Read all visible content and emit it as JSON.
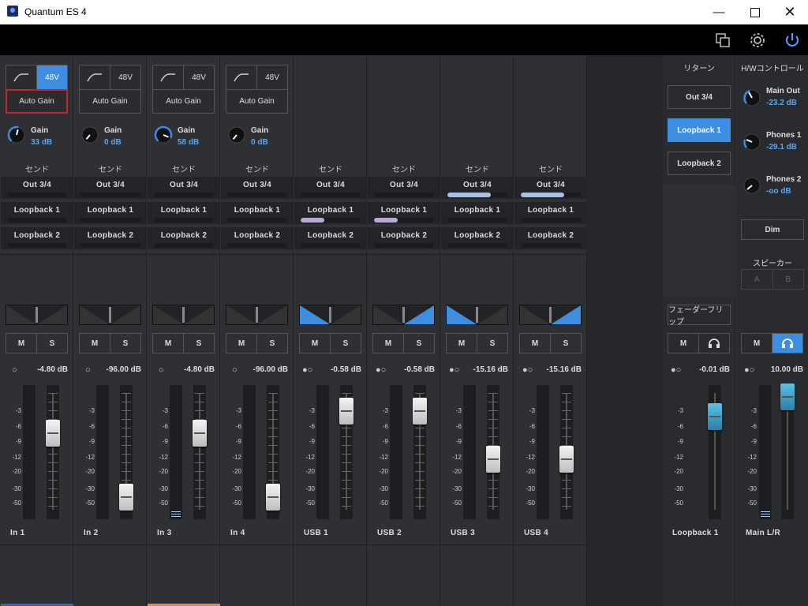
{
  "window": {
    "title": "Quantum ES 4"
  },
  "strips": [
    {
      "name": "In  1",
      "type": "input",
      "v48": "48V",
      "v48_on": true,
      "auto_gain": "Auto Gain",
      "auto_gain_selected": true,
      "gain_label": "Gain",
      "gain": "33 dB",
      "gain_level": 0.55,
      "send_header": "センド",
      "sends": [
        {
          "label": "Out  3/4",
          "level": 0
        },
        {
          "label": "Loopback  1",
          "level": 0
        },
        {
          "label": "Loopback  2",
          "level": 0
        }
      ],
      "pan": "center",
      "mute": "M",
      "solo": "S",
      "db": "-4.80 dB",
      "linked": false,
      "fader_level": 0.66,
      "meter_level": 0,
      "color": "#2d5fe0"
    },
    {
      "name": "In  2",
      "type": "input",
      "v48": "48V",
      "v48_on": false,
      "auto_gain": "Auto Gain",
      "auto_gain_selected": false,
      "gain_label": "Gain",
      "gain": "0 dB",
      "gain_level": 0,
      "send_header": "センド",
      "sends": [
        {
          "label": "Out  3/4",
          "level": 0
        },
        {
          "label": "Loopback  1",
          "level": 0
        },
        {
          "label": "Loopback  2",
          "level": 0
        }
      ],
      "pan": "center",
      "mute": "M",
      "solo": "S",
      "db": "-96.00 dB",
      "linked": false,
      "fader_level": 0.12,
      "meter_level": 0,
      "color": ""
    },
    {
      "name": "In  3",
      "type": "input",
      "v48": "48V",
      "v48_on": false,
      "auto_gain": "Auto Gain",
      "auto_gain_selected": false,
      "gain_label": "Gain",
      "gain": "58 dB",
      "gain_level": 0.9,
      "send_header": "センド",
      "sends": [
        {
          "label": "Out  3/4",
          "level": 0
        },
        {
          "label": "Loopback  1",
          "level": 0
        },
        {
          "label": "Loopback  2",
          "level": 0
        }
      ],
      "pan": "center",
      "mute": "M",
      "solo": "S",
      "db": "-4.80 dB",
      "linked": false,
      "fader_level": 0.66,
      "meter_level": 0.04,
      "color": "#e58a3c"
    },
    {
      "name": "In  4",
      "type": "input",
      "v48": "48V",
      "v48_on": false,
      "auto_gain": "Auto Gain",
      "auto_gain_selected": false,
      "gain_label": "Gain",
      "gain": "0 dB",
      "gain_level": 0,
      "send_header": "センド",
      "sends": [
        {
          "label": "Out  3/4",
          "level": 0
        },
        {
          "label": "Loopback  1",
          "level": 0
        },
        {
          "label": "Loopback  2",
          "level": 0
        }
      ],
      "pan": "center",
      "mute": "M",
      "solo": "S",
      "db": "-96.00 dB",
      "linked": false,
      "fader_level": 0.12,
      "meter_level": 0,
      "color": ""
    },
    {
      "name": "USB  1",
      "type": "usb",
      "send_header": "センド",
      "sends": [
        {
          "label": "Out  3/4",
          "level": 0
        },
        {
          "label": "Loopback  1",
          "level": 0.4
        },
        {
          "label": "Loopback  2",
          "level": 0
        }
      ],
      "pan": "left",
      "mute": "M",
      "solo": "S",
      "db": "-0.58 dB",
      "linked": true,
      "fader_level": 0.85,
      "meter_level": 0,
      "color": ""
    },
    {
      "name": "USB  2",
      "type": "usb",
      "send_header": "センド",
      "sends": [
        {
          "label": "Out  3/4",
          "level": 0
        },
        {
          "label": "Loopback  1",
          "level": 0.4
        },
        {
          "label": "Loopback  2",
          "level": 0
        }
      ],
      "pan": "right",
      "mute": "M",
      "solo": "S",
      "db": "-0.58 dB",
      "linked": true,
      "fader_level": 0.85,
      "meter_level": 0,
      "color": ""
    },
    {
      "name": "USB  3",
      "type": "usb",
      "send_header": "センド",
      "sends": [
        {
          "label": "Out  3/4",
          "level": 0.72
        },
        {
          "label": "Loopback  1",
          "level": 0
        },
        {
          "label": "Loopback  2",
          "level": 0
        }
      ],
      "pan": "left",
      "mute": "M",
      "solo": "S",
      "db": "-15.16 dB",
      "linked": true,
      "fader_level": 0.44,
      "meter_level": 0,
      "color": ""
    },
    {
      "name": "USB  4",
      "type": "usb",
      "send_header": "センド",
      "sends": [
        {
          "label": "Out  3/4",
          "level": 0.72
        },
        {
          "label": "Loopback  1",
          "level": 0
        },
        {
          "label": "Loopback  2",
          "level": 0
        }
      ],
      "pan": "right",
      "mute": "M",
      "solo": "S",
      "db": "-15.16 dB",
      "linked": true,
      "fader_level": 0.44,
      "meter_level": 0,
      "color": ""
    }
  ],
  "return": {
    "header": "リターン",
    "buttons": [
      {
        "label": "Out  3/4",
        "on": false
      },
      {
        "label": "Loopback  1",
        "on": true
      },
      {
        "label": "Loopback  2",
        "on": false
      }
    ],
    "fader_flip": "フェーダーフリップ",
    "mute": "M",
    "headphone_icon": "headphone-icon",
    "db": "-0.01 dB",
    "linked": true,
    "fader_level": 0.8,
    "name": "Loopback  1"
  },
  "hw": {
    "header": "H/Wコントロール",
    "outputs": [
      {
        "name": "Main Out",
        "value": "-23.2 dB",
        "level": 0.45
      },
      {
        "name": "Phones 1",
        "value": "-29.1 dB",
        "level": 0.35
      },
      {
        "name": "Phones 2",
        "value": "-oo dB",
        "level": 0
      }
    ],
    "dim": "Dim",
    "speaker_header": "スピーカー",
    "speaker_a": "A",
    "speaker_b": "B",
    "mute": "M",
    "headphone_icon": "headphone-icon",
    "db": "10.00 dB",
    "linked": true,
    "fader_level": 0.97,
    "meter_level": 0.04,
    "name": "Main L/R"
  },
  "scale_labels": [
    "-3",
    "-6",
    "-9",
    "-12",
    "-20",
    "-30",
    "-50"
  ],
  "colors": {
    "accent": "#3d8ee0",
    "value_text": "#5aa6ef",
    "send_fill": "#b9a9d9",
    "send_fill_out": "#a9bfe6"
  }
}
